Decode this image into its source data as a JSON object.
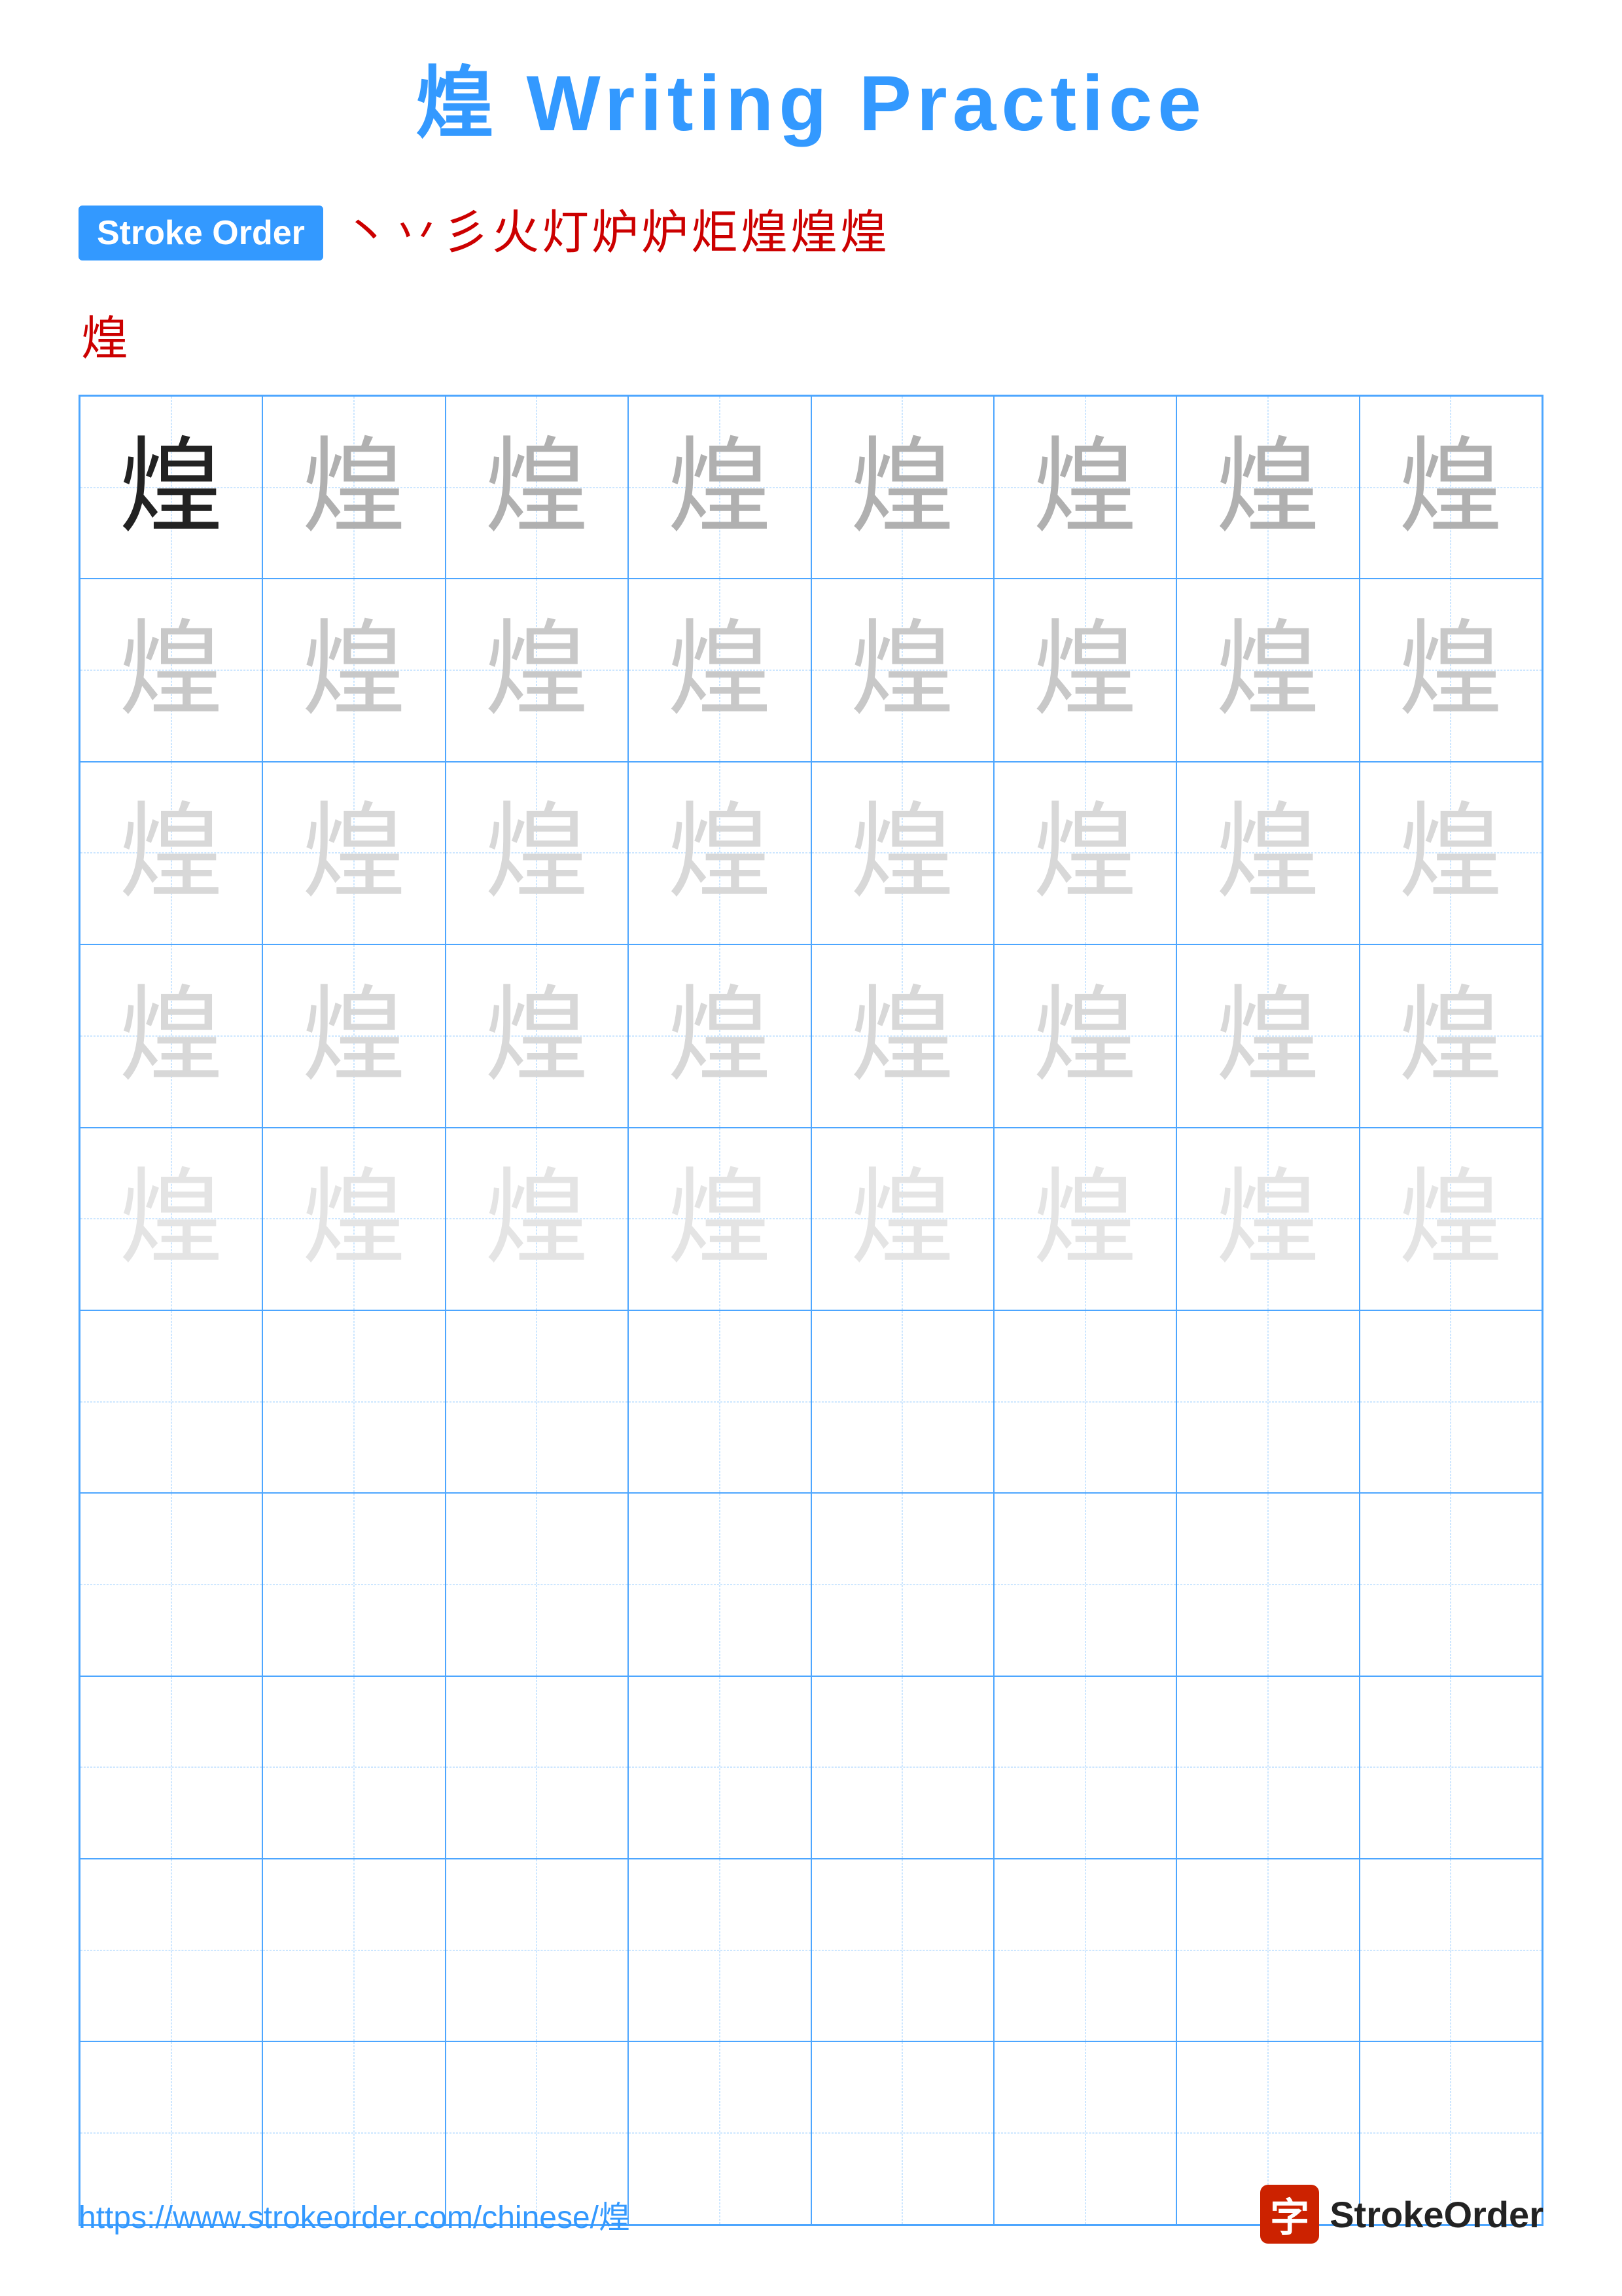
{
  "page": {
    "title": "煌 Writing Practice",
    "title_char": "煌",
    "title_text": "Writing Practice"
  },
  "stroke_order": {
    "badge_label": "Stroke Order",
    "strokes": [
      "丶",
      "丷",
      "彡",
      "火",
      "火丿",
      "炉",
      "炉丶",
      "炉亻",
      "煌",
      "煌",
      "煌"
    ],
    "row2_char": "煌"
  },
  "character": "煌",
  "grid": {
    "rows": 10,
    "cols": 8,
    "practice_rows_with_chars": 5,
    "opacity_levels": [
      "dark",
      "light1",
      "light2",
      "light3",
      "light4"
    ]
  },
  "footer": {
    "url": "https://www.strokeorder.com/chinese/煌",
    "logo_char": "字",
    "logo_name": "StrokeOrder"
  }
}
